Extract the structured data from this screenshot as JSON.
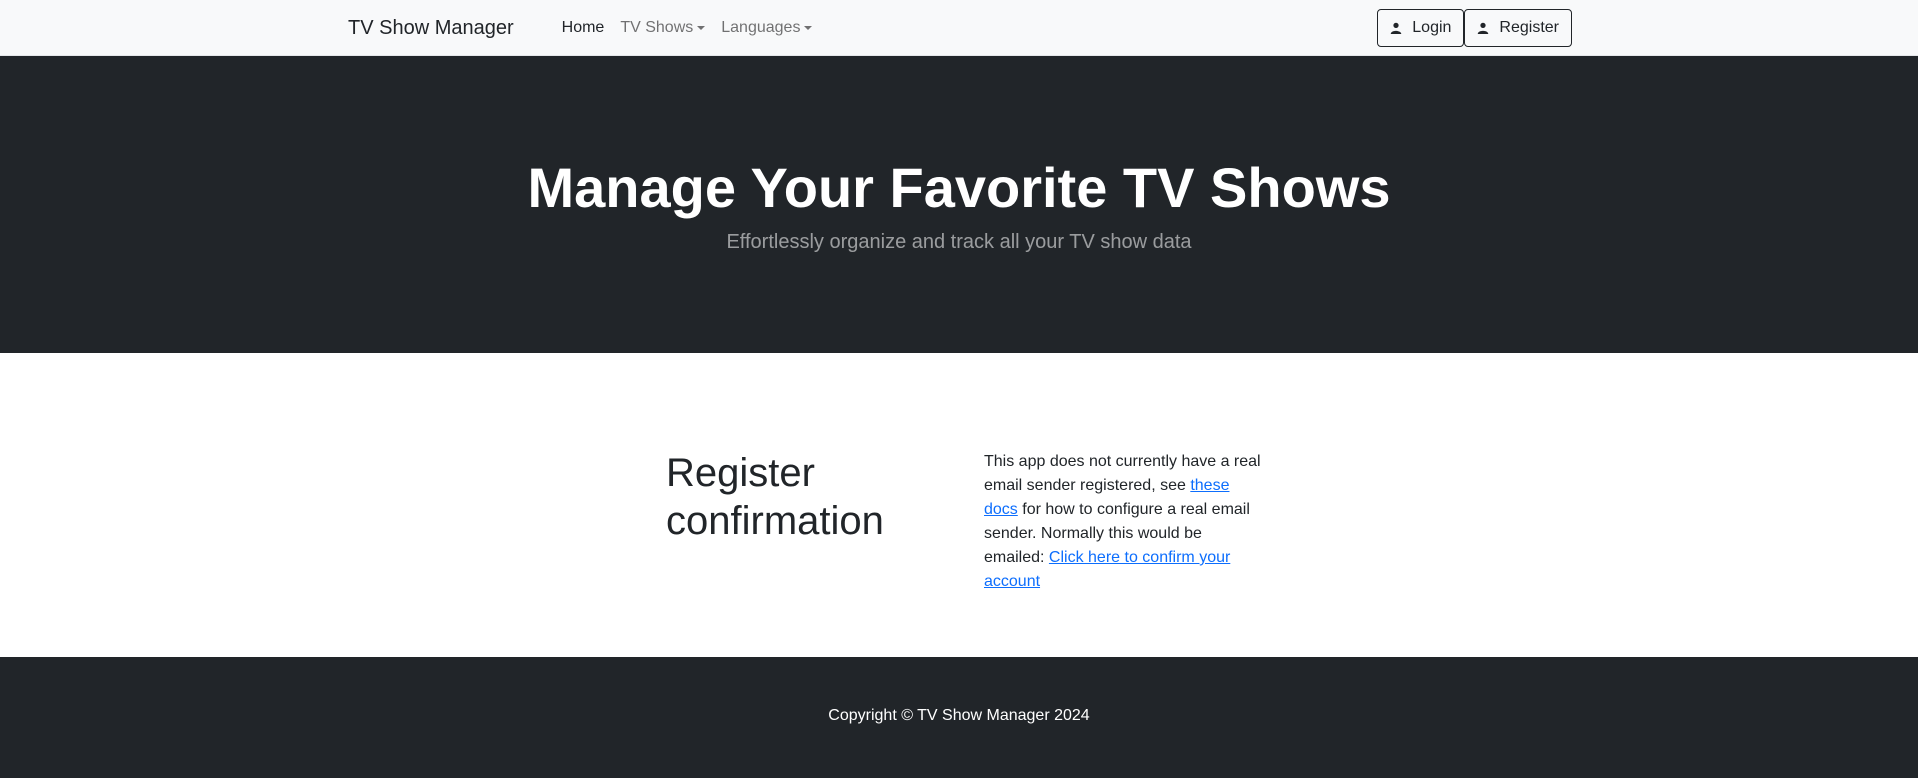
{
  "navbar": {
    "brand": "TV Show Manager",
    "links": [
      {
        "label": "Home"
      },
      {
        "label": "TV Shows"
      },
      {
        "label": "Languages"
      }
    ],
    "login_label": "Login",
    "register_label": "Register"
  },
  "hero": {
    "title": "Manage Your Favorite TV Shows",
    "subtitle": "Effortlessly organize and track all your TV show data"
  },
  "main": {
    "heading": "Register confirmation",
    "text_before_link1": "This app does not currently have a real email sender registered, see ",
    "link1": "these docs",
    "text_between": " for how to configure a real email sender. Normally this would be emailed: ",
    "link2": "Click here to confirm your account"
  },
  "footer": {
    "copyright": "Copyright © TV Show Manager 2024"
  },
  "colors": {
    "dark": "#212529",
    "light": "#f8f9fa",
    "link": "#0d6efd"
  }
}
